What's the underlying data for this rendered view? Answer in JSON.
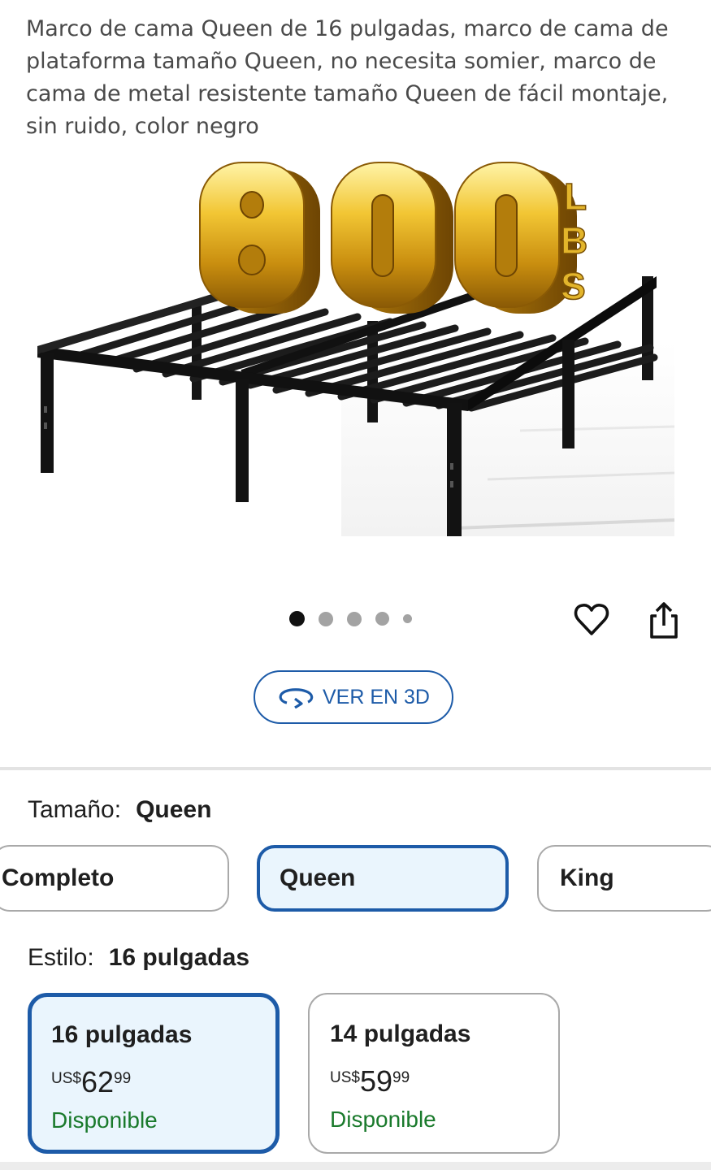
{
  "product": {
    "title": "Marco de cama Queen de 16 pulgadas, marco de cama de plataforma tamaño Queen, no necesita somier, marco de cama de metal resistente tamaño Queen de fácil montaje, sin ruido, color negro",
    "image_badge": {
      "number": "800",
      "unit": "LBS"
    }
  },
  "carousel": {
    "count": 5,
    "active_index": 0
  },
  "actions": {
    "favorite_icon": "heart-icon",
    "share_icon": "share-icon"
  },
  "view3d": {
    "label": "VER EN 3D",
    "icon": "rotate-3d-icon"
  },
  "size": {
    "label": "Tamaño:",
    "selected": "Queen",
    "options": [
      "Completo",
      "Queen",
      "King"
    ]
  },
  "style": {
    "label": "Estilo:",
    "selected": "16 pulgadas",
    "options": [
      {
        "name": "16 pulgadas",
        "currency": "US$",
        "price_int": "62",
        "price_dec": "99",
        "status": "Disponible"
      },
      {
        "name": "14 pulgadas",
        "currency": "US$",
        "price_int": "59",
        "price_dec": "99",
        "status": "Disponible"
      }
    ]
  },
  "colors": {
    "accent": "#1d5ba8",
    "selected_bg": "#eaf5fd",
    "available": "#1a7a2c",
    "badge_gold": "#d9a91a"
  }
}
